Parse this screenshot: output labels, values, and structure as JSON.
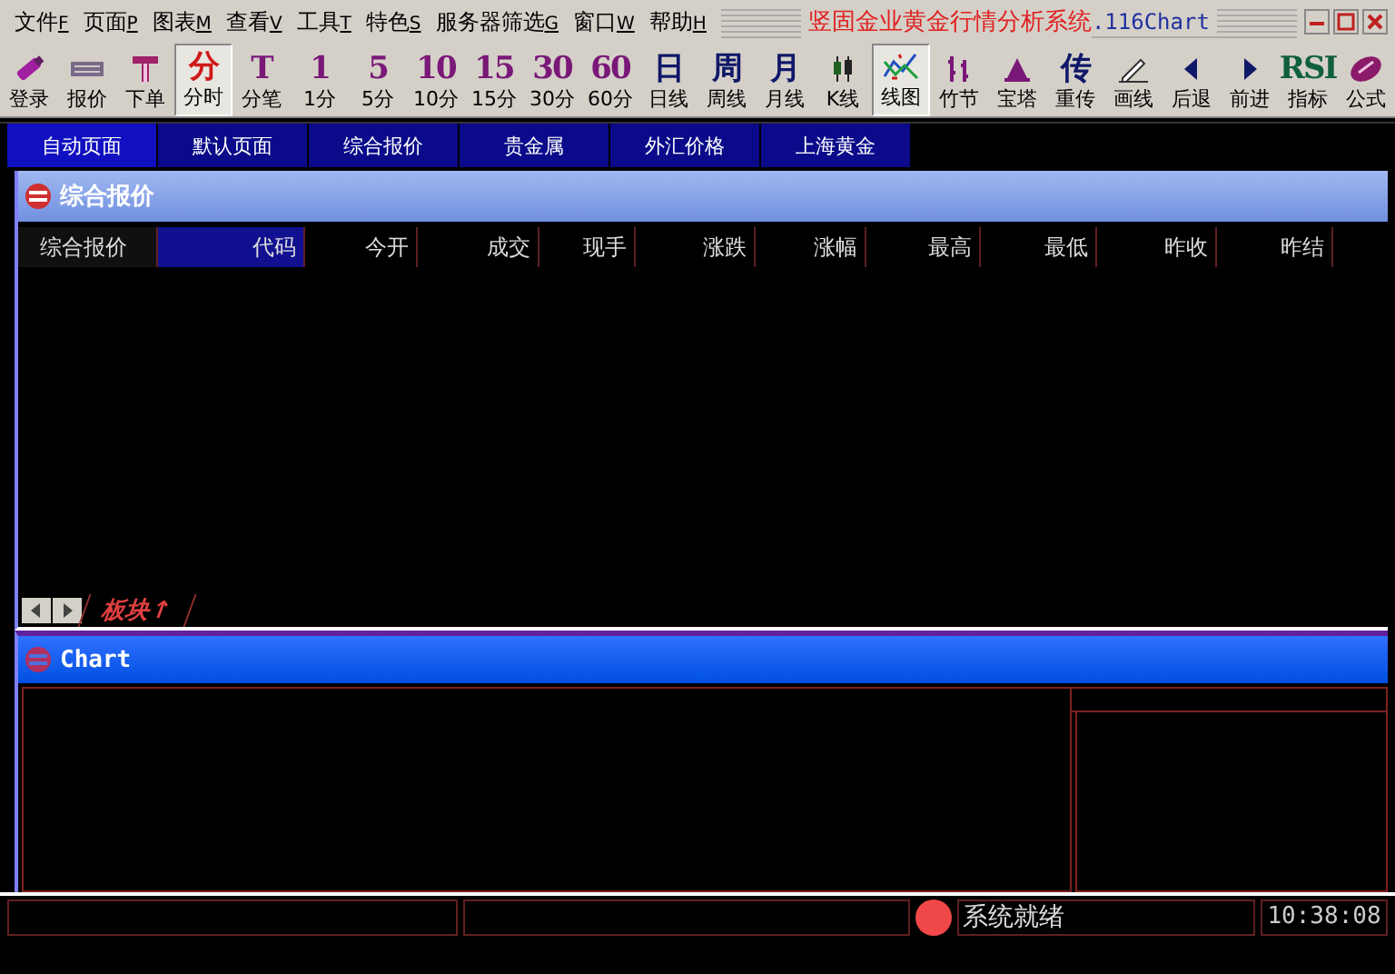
{
  "menu": [
    {
      "label": "文件",
      "key": "F"
    },
    {
      "label": "页面",
      "key": "P"
    },
    {
      "label": "图表",
      "key": "M"
    },
    {
      "label": "查看",
      "key": "V"
    },
    {
      "label": "工具",
      "key": "T"
    },
    {
      "label": "特色",
      "key": "S"
    },
    {
      "label": "服务器筛选",
      "key": "G"
    },
    {
      "label": "窗口",
      "key": "W"
    },
    {
      "label": "帮助",
      "key": "H"
    }
  ],
  "window": {
    "title": "竖固金业黄金行情分析系统",
    "version": ".116Chart"
  },
  "toolbar": [
    {
      "label": "登录",
      "kind": "icon",
      "selected": false
    },
    {
      "label": "报价",
      "kind": "icon",
      "selected": false
    },
    {
      "label": "下单",
      "kind": "icon",
      "selected": false
    },
    {
      "label": "分时",
      "kind": "glyph",
      "glyph": "分",
      "color": "#d01818",
      "selected": true
    },
    {
      "label": "分笔",
      "kind": "glyph",
      "glyph": "T",
      "color": "#7a1878",
      "selected": false
    },
    {
      "label": "1分",
      "kind": "glyph",
      "glyph": "1",
      "color": "#7a1878",
      "selected": false
    },
    {
      "label": "5分",
      "kind": "glyph",
      "glyph": "5",
      "color": "#7a1878",
      "selected": false
    },
    {
      "label": "10分",
      "kind": "glyph",
      "glyph": "10",
      "color": "#7a1878",
      "selected": false
    },
    {
      "label": "15分",
      "kind": "glyph",
      "glyph": "15",
      "color": "#7a1878",
      "selected": false
    },
    {
      "label": "30分",
      "kind": "glyph",
      "glyph": "30",
      "color": "#7a1878",
      "selected": false
    },
    {
      "label": "60分",
      "kind": "glyph",
      "glyph": "60",
      "color": "#7a1878",
      "selected": false
    },
    {
      "label": "日线",
      "kind": "glyph",
      "glyph": "日",
      "color": "#101868",
      "selected": false
    },
    {
      "label": "周线",
      "kind": "glyph",
      "glyph": "周",
      "color": "#101868",
      "selected": false
    },
    {
      "label": "月线",
      "kind": "glyph",
      "glyph": "月",
      "color": "#101868",
      "selected": false
    },
    {
      "label": "K线",
      "kind": "icon",
      "selected": false
    },
    {
      "label": "线图",
      "kind": "icon",
      "selected": true
    },
    {
      "label": "竹节",
      "kind": "icon",
      "selected": false
    },
    {
      "label": "宝塔",
      "kind": "icon",
      "selected": false
    },
    {
      "label": "重传",
      "kind": "glyph",
      "glyph": "传",
      "color": "#101868",
      "selected": false
    },
    {
      "label": "画线",
      "kind": "icon",
      "selected": false
    },
    {
      "label": "后退",
      "kind": "icon",
      "selected": false
    },
    {
      "label": "前进",
      "kind": "icon",
      "selected": false
    },
    {
      "label": "指标",
      "kind": "glyph",
      "glyph": "RSI",
      "color": "#10603a",
      "selected": false
    },
    {
      "label": "公式",
      "kind": "icon",
      "selected": false
    }
  ],
  "page_tabs": [
    {
      "label": "自动页面",
      "selected": true
    },
    {
      "label": "默认页面",
      "selected": false
    },
    {
      "label": "综合报价",
      "selected": false
    },
    {
      "label": "贵金属",
      "selected": false
    },
    {
      "label": "外汇价格",
      "selected": false
    },
    {
      "label": "上海黄金",
      "selected": false
    }
  ],
  "quote_panel": {
    "title": "综合报价",
    "columns": [
      {
        "label": "综合报价",
        "selected": false
      },
      {
        "label": "代码",
        "selected": true
      },
      {
        "label": "今开",
        "selected": false
      },
      {
        "label": "成交",
        "selected": false
      },
      {
        "label": "现手",
        "selected": false
      },
      {
        "label": "涨跌",
        "selected": false
      },
      {
        "label": "涨幅",
        "selected": false
      },
      {
        "label": "最高",
        "selected": false
      },
      {
        "label": "最低",
        "selected": false
      },
      {
        "label": "昨收",
        "selected": false
      },
      {
        "label": "昨结",
        "selected": false
      }
    ],
    "sheet_tab": "板块↑"
  },
  "chart_panel": {
    "title": "Chart"
  },
  "status_bar": {
    "message": "系统就绪",
    "time": "10:38:08"
  }
}
